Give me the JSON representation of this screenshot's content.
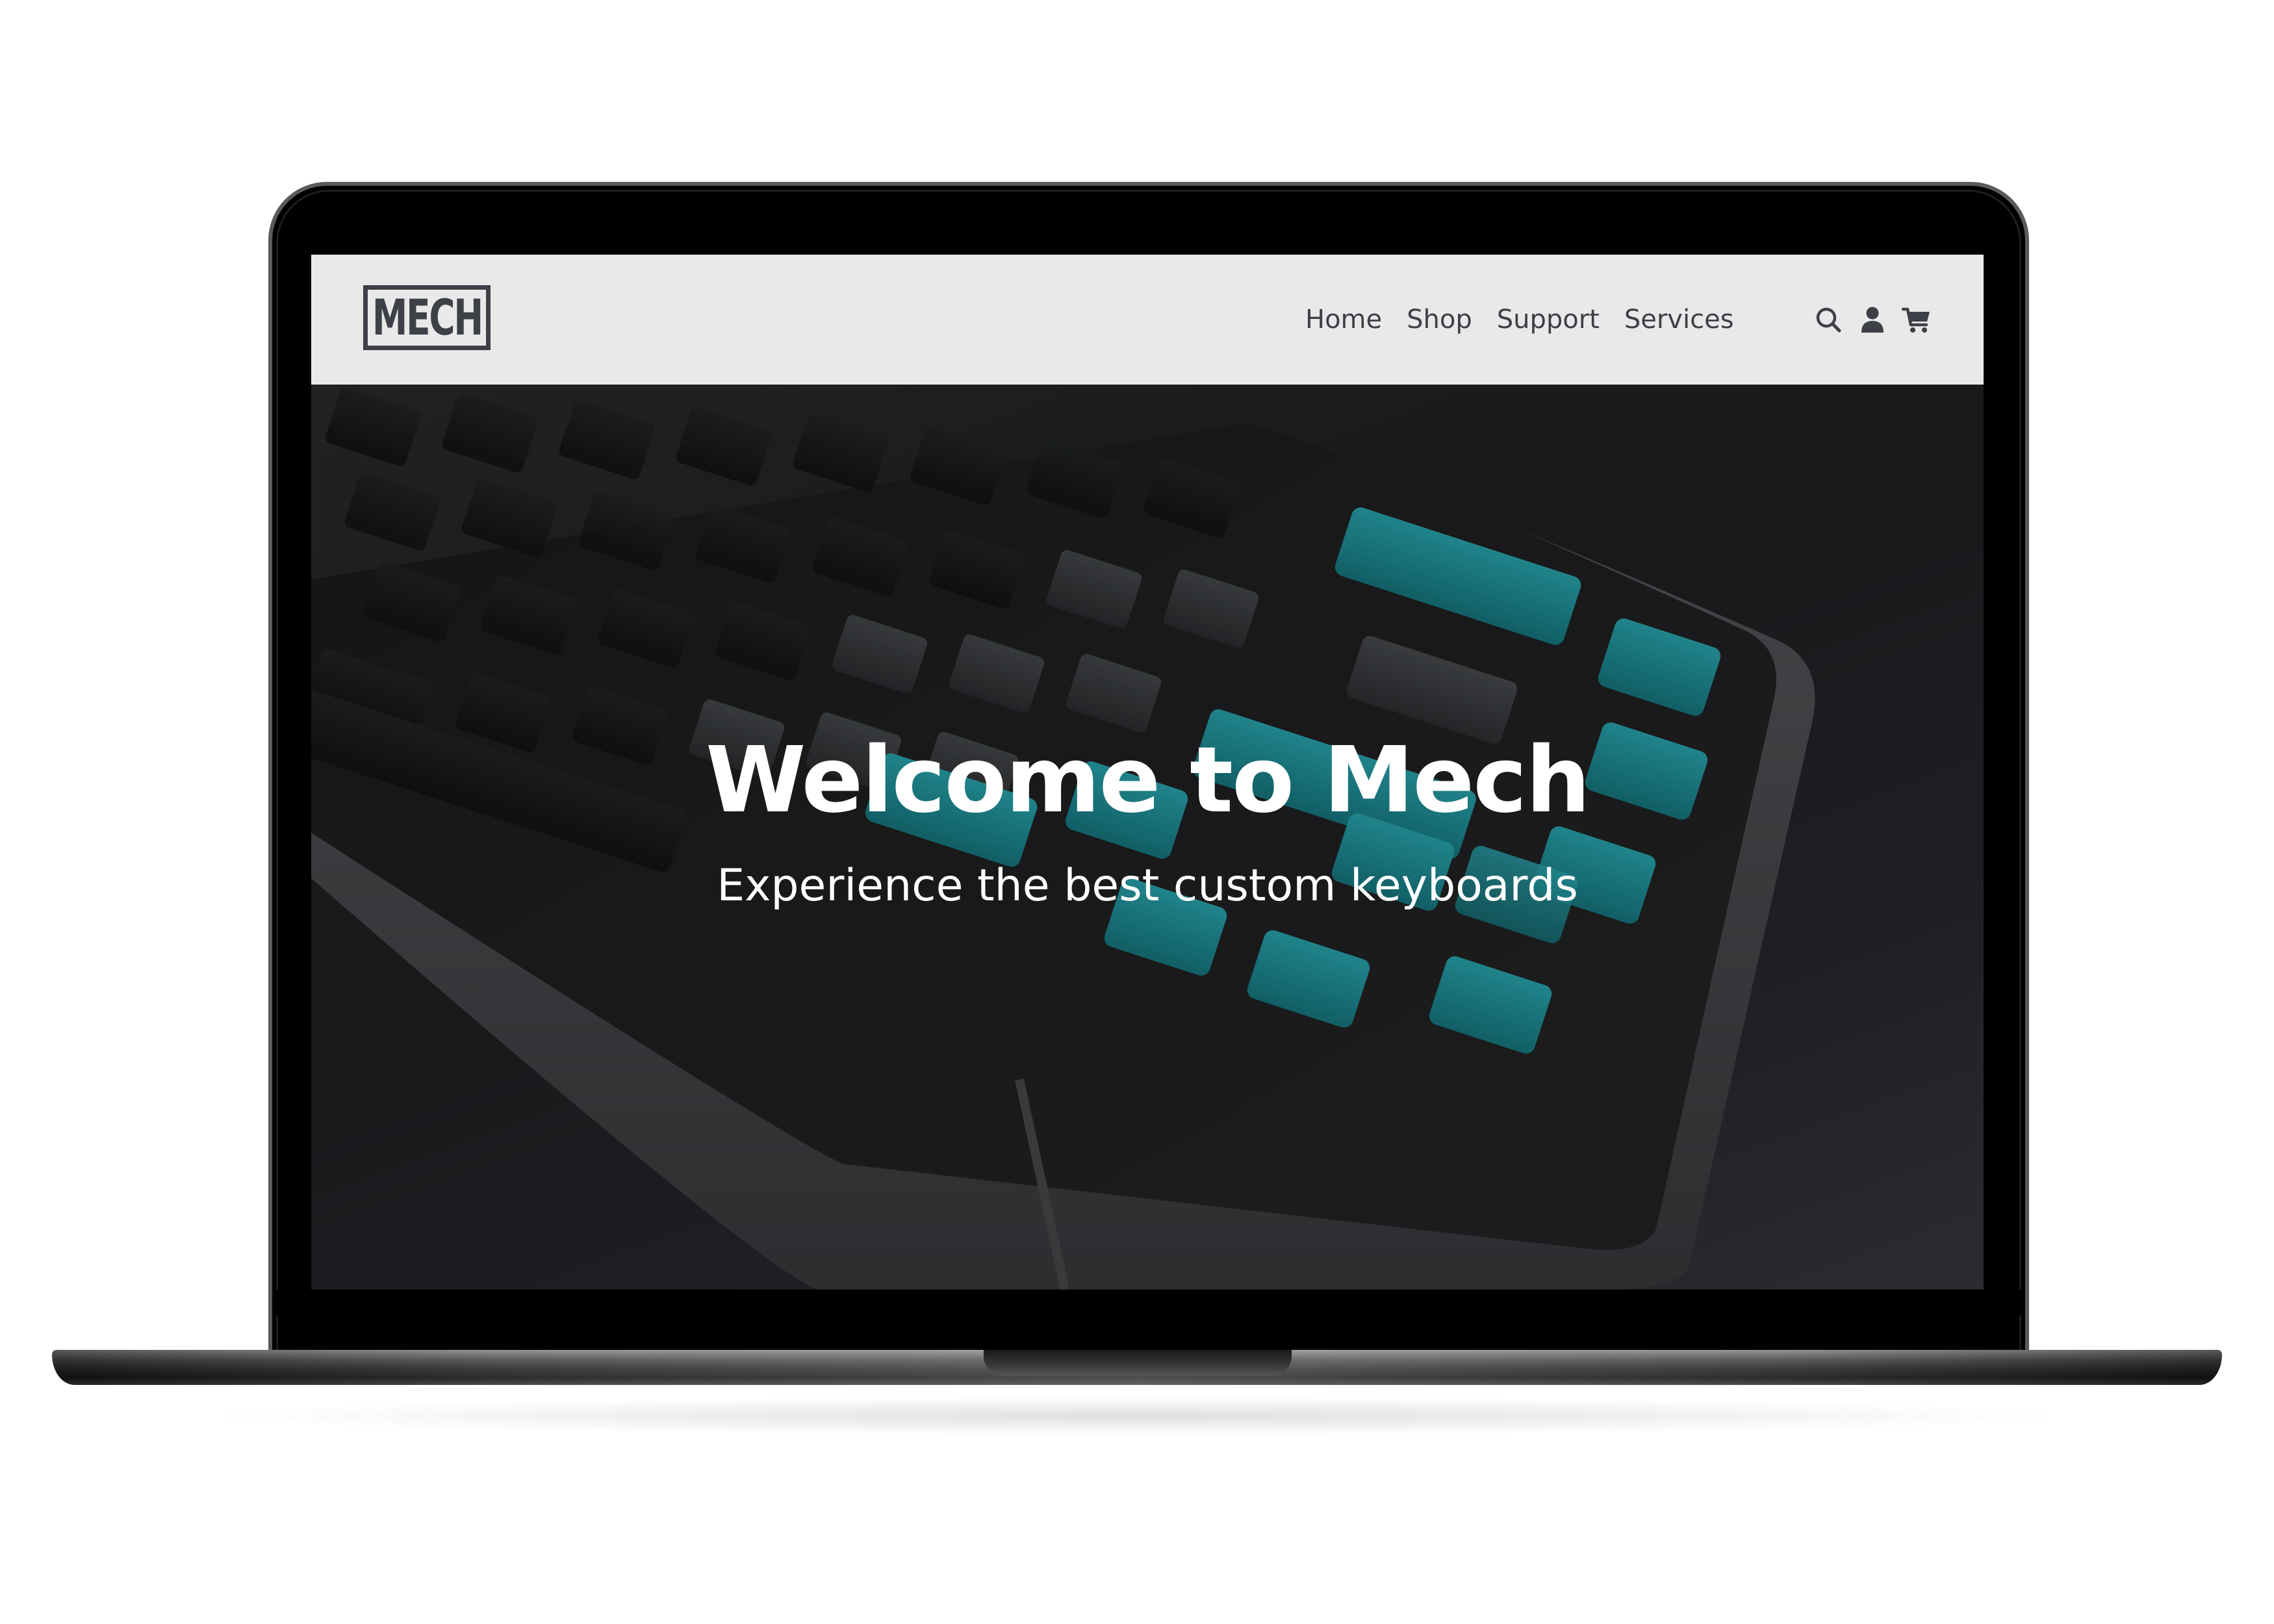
{
  "brand": {
    "logo_text": "MECH"
  },
  "nav": {
    "links": [
      {
        "label": "Home"
      },
      {
        "label": "Shop"
      },
      {
        "label": "Support"
      },
      {
        "label": "Services"
      }
    ],
    "icons": [
      "search-icon",
      "user-icon",
      "cart-icon"
    ]
  },
  "hero": {
    "title": "Welcome to Mech",
    "subtitle": "Experience the best custom keyboards",
    "image": "custom-mechanical-keyboard-photo"
  },
  "colors": {
    "navbar_bg": "#e9e9ea",
    "nav_text": "#3d4046",
    "accent_keycap": "#1f9aa3",
    "hero_text": "#ffffff"
  }
}
